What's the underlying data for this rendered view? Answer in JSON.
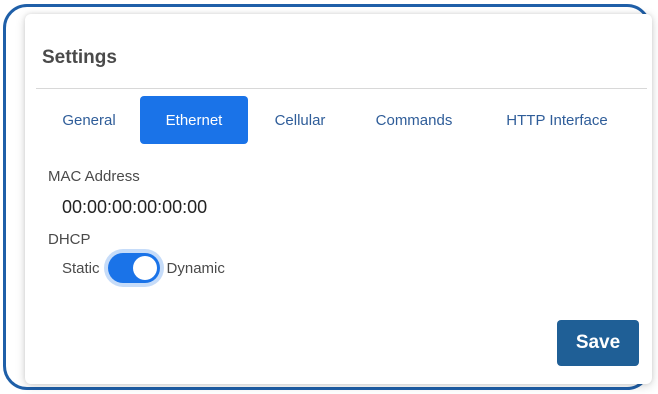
{
  "card": {
    "title": "Settings"
  },
  "tabs": [
    {
      "label": "General",
      "active": false
    },
    {
      "label": "Ethernet",
      "active": true
    },
    {
      "label": "Cellular",
      "active": false
    },
    {
      "label": "Commands",
      "active": false
    },
    {
      "label": "HTTP Interface",
      "active": false
    }
  ],
  "mac": {
    "label": "MAC Address",
    "value": "00:00:00:00:00:00"
  },
  "dhcp": {
    "label": "DHCP",
    "left_option": "Static",
    "right_option": "Dynamic",
    "state": "Dynamic"
  },
  "actions": {
    "save_label": "Save"
  },
  "colors": {
    "accent": "#1a73e8",
    "save_button": "#1f5f96",
    "frame_border": "#1f5fa8",
    "tab_text": "#2f5d99"
  }
}
